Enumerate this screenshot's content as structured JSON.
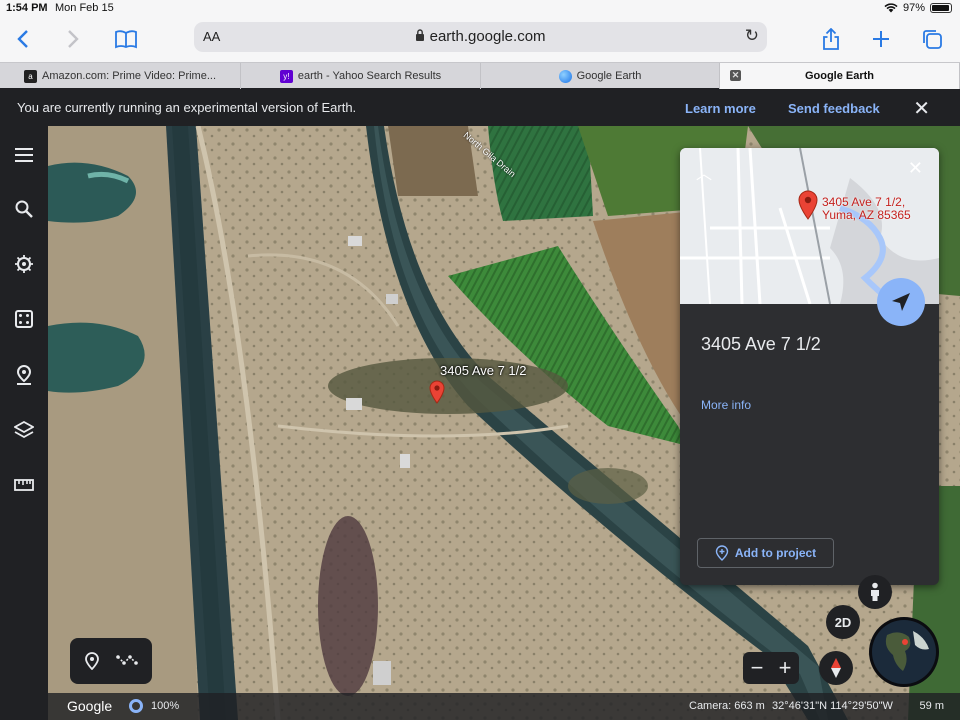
{
  "status_bar": {
    "time": "1:54 PM",
    "date": "Mon Feb 15",
    "battery": "97%",
    "battery_level": 0.97
  },
  "browser": {
    "text_size_label": "AA",
    "url": "earth.google.com",
    "tabs": [
      {
        "label": "Amazon.com: Prime Video: Prime...",
        "favicon": "a"
      },
      {
        "label": "earth - Yahoo Search Results",
        "favicon": "y!"
      },
      {
        "label": "Google Earth",
        "favicon": ""
      },
      {
        "label": "Google Earth",
        "favicon": ""
      }
    ]
  },
  "banner": {
    "message": "You are currently running an experimental version of Earth.",
    "learn_more": "Learn more",
    "send_feedback": "Send feedback"
  },
  "map": {
    "place_label": "3405 Ave 7 1/2",
    "drain_label": "North Gila Drain"
  },
  "card": {
    "mini_map_address_line1": "3405 Ave 7 1/2,",
    "mini_map_address_line2": "Yuma, AZ 85365",
    "title": "3405 Ave 7 1/2",
    "more_info": "More info",
    "add_to_project": "Add to project"
  },
  "controls": {
    "view_toggle": "2D"
  },
  "bottom_bar": {
    "logo": "Google",
    "load_percent": "100%",
    "camera": "Camera: 663 m",
    "coordinates": "32°46'31\"N 114°29'50\"W",
    "scale": "59 m"
  },
  "colors": {
    "accent": "#8ab4f8",
    "pin": "#ea4335",
    "panel": "#202124"
  }
}
